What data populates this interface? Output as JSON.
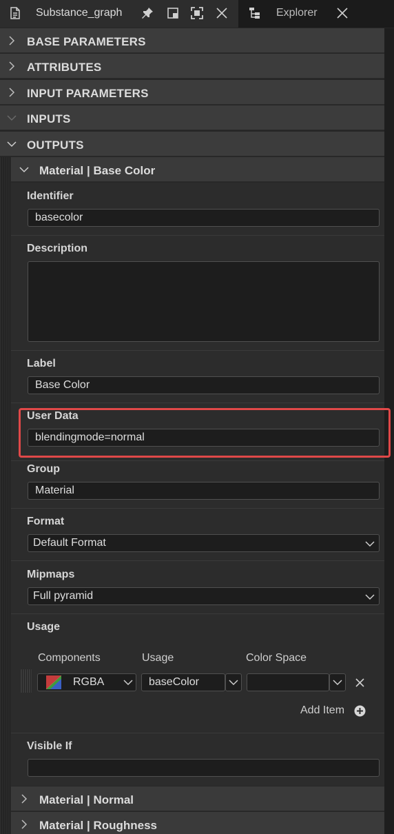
{
  "tabs": {
    "active": {
      "title": "Substance_graph",
      "icon": "document-icon"
    },
    "actions": [
      "pin-icon",
      "float-window-icon",
      "maximize-icon",
      "close-icon"
    ],
    "inactive": {
      "title": "Explorer",
      "icon": "tree-icon"
    }
  },
  "sections": {
    "base_parameters": "BASE PARAMETERS",
    "attributes": "ATTRIBUTES",
    "input_parameters": "INPUT PARAMETERS",
    "inputs": "INPUTS",
    "outputs": "OUTPUTS"
  },
  "output_base_color": {
    "header": "Material | Base Color",
    "identifier_label": "Identifier",
    "identifier_value": "basecolor",
    "description_label": "Description",
    "description_value": "",
    "label_label": "Label",
    "label_value": "Base Color",
    "user_data_label": "User Data",
    "user_data_value": "blendingmode=normal",
    "group_label": "Group",
    "group_value": "Material",
    "format_label": "Format",
    "format_value": "Default Format",
    "mipmaps_label": "Mipmaps",
    "mipmaps_value": "Full pyramid",
    "usage_label": "Usage",
    "usage_table": {
      "col_components": "Components",
      "col_usage": "Usage",
      "col_color_space": "Color Space",
      "row": {
        "components": "RGBA",
        "usage": "baseColor",
        "color_space": ""
      },
      "add_item": "Add Item"
    },
    "visible_if_label": "Visible If",
    "visible_if_value": ""
  },
  "other_outputs": {
    "normal": "Material | Normal",
    "roughness": "Material | Roughness"
  },
  "colors": {
    "highlight": "#e04848",
    "header_bg": "#3c3c3c",
    "input_bg": "#1d1d1d"
  }
}
